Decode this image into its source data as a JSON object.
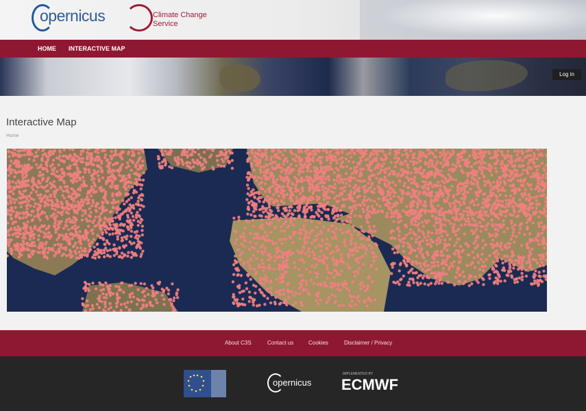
{
  "header": {
    "copernicus_logo_text": "opernicus",
    "climate_logo_line1": "Climate Change",
    "climate_logo_line2": "Service"
  },
  "nav": {
    "home": "HOME",
    "interactive_map": "INTERACTIVE MAP"
  },
  "banner": {
    "login_label": "Log in"
  },
  "main": {
    "title": "Interactive Map",
    "breadcrumb": "Home"
  },
  "map": {
    "colors": {
      "ocean": "#1b2a52",
      "land": "#9b8a5e",
      "marker": "#f08080"
    }
  },
  "footer": {
    "links": [
      "About C3S",
      "Contact us",
      "Cookies",
      "Disclaimer / Privacy"
    ],
    "ecmwf_tagline": "IMPLEMENTED BY",
    "ecmwf_logo_text": "ECMWF",
    "copernicus_logo_text": "opernicus"
  }
}
